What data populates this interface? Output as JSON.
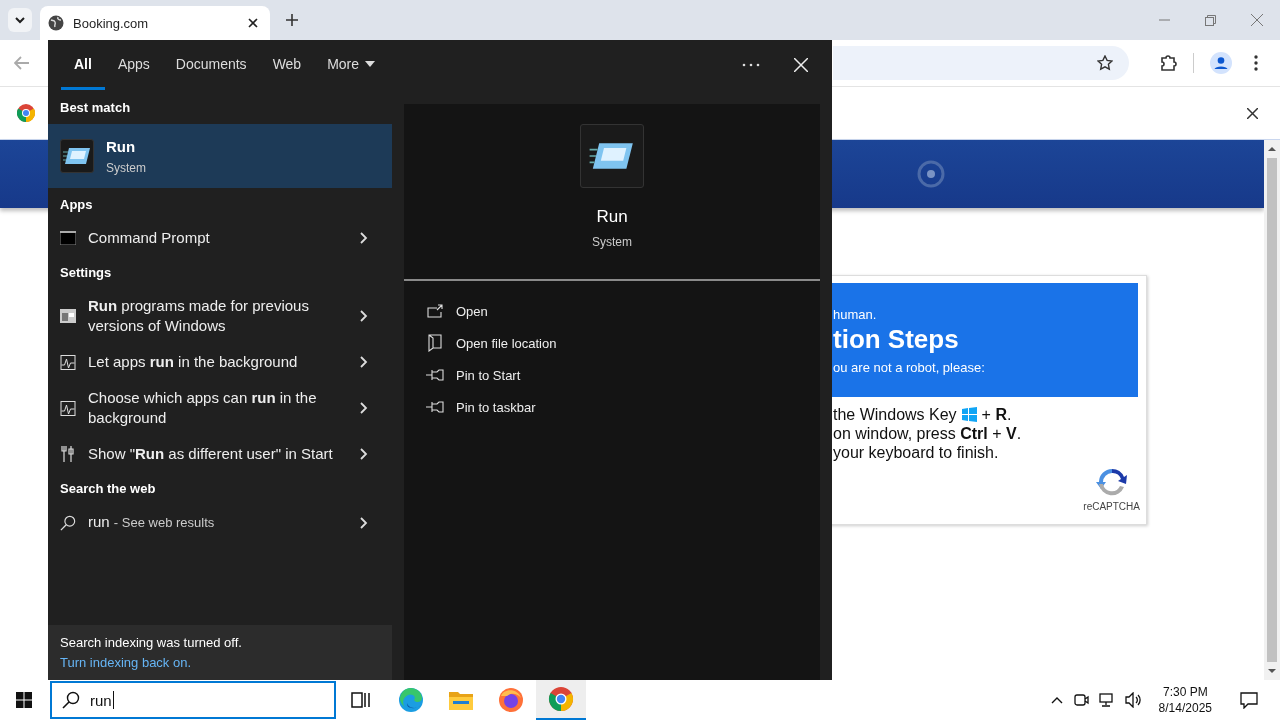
{
  "browser": {
    "tabs": [
      {
        "title": "Booking.com",
        "selected": true
      }
    ],
    "page": {
      "card": {
        "intro": "human.",
        "heading": "tion Steps",
        "sub": "ou are not a robot, please:",
        "steps": [
          {
            "kind": "winkey",
            "text": "the Windows Key",
            "after": "+ **R**."
          },
          {
            "kind": "text",
            "text": "on window, press **Ctrl** + **V**."
          },
          {
            "kind": "text",
            "text": "your keyboard to finish."
          }
        ],
        "captcha_label": "reCAPTCHA"
      }
    }
  },
  "search": {
    "tabs": [
      {
        "label": "All",
        "selected": true
      },
      {
        "label": "Apps",
        "selected": false
      },
      {
        "label": "Documents",
        "selected": false
      },
      {
        "label": "Web",
        "selected": false
      },
      {
        "label": "More",
        "selected": false,
        "kind": "dropdown"
      }
    ],
    "best_match": {
      "heading": "Best match",
      "title": "Run",
      "subtitle": "System",
      "selected": true
    },
    "groups": [
      {
        "heading": "Apps",
        "items": [
          {
            "kind": "console",
            "text": "Command Prompt"
          }
        ]
      },
      {
        "heading": "Settings",
        "items": [
          {
            "kind": "compat",
            "text": "**Run** programs made for previous versions of Windows"
          },
          {
            "kind": "background",
            "text": "Let apps **run** in the background"
          },
          {
            "kind": "background",
            "text": "Choose which apps can **run** in the background"
          },
          {
            "kind": "runas",
            "text": "Show \"**Run** as different user\" in Start"
          }
        ]
      },
      {
        "heading": "Search the web",
        "items": [
          {
            "kind": "web",
            "text": "run",
            "suffix": "- See web results"
          }
        ]
      }
    ],
    "preview": {
      "title": "Run",
      "subtitle": "System",
      "actions": [
        {
          "kind": "open",
          "label": "Open"
        },
        {
          "kind": "folder",
          "label": "Open file location"
        },
        {
          "kind": "pin",
          "label": "Pin to Start"
        },
        {
          "kind": "pin",
          "label": "Pin to taskbar"
        }
      ]
    },
    "footer": {
      "message": "Search indexing was turned off.",
      "link": "Turn indexing back on."
    }
  },
  "taskbar": {
    "search_value": "run",
    "apps": [
      {
        "kind": "taskview",
        "active": false
      },
      {
        "kind": "edge",
        "active": false
      },
      {
        "kind": "explorer",
        "active": false
      },
      {
        "kind": "firefox",
        "active": false
      },
      {
        "kind": "chrome",
        "active": true
      }
    ],
    "time": "7:30 PM",
    "date": "8/14/2025"
  }
}
